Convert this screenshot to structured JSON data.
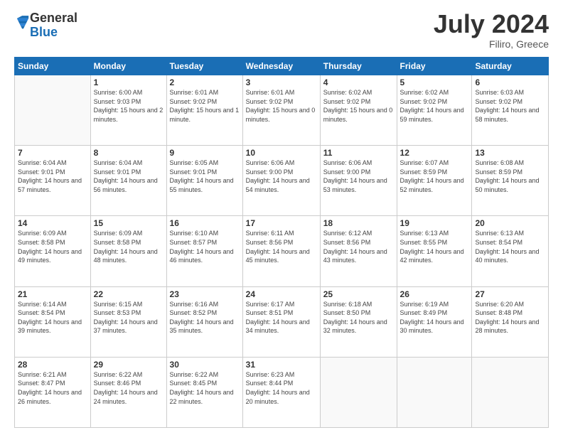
{
  "logo": {
    "general": "General",
    "blue": "Blue"
  },
  "title": {
    "month_year": "July 2024",
    "location": "Filiro, Greece"
  },
  "weekdays": [
    "Sunday",
    "Monday",
    "Tuesday",
    "Wednesday",
    "Thursday",
    "Friday",
    "Saturday"
  ],
  "weeks": [
    [
      {
        "day": "",
        "sunrise": "",
        "sunset": "",
        "daylight": ""
      },
      {
        "day": "1",
        "sunrise": "Sunrise: 6:00 AM",
        "sunset": "Sunset: 9:03 PM",
        "daylight": "Daylight: 15 hours and 2 minutes."
      },
      {
        "day": "2",
        "sunrise": "Sunrise: 6:01 AM",
        "sunset": "Sunset: 9:02 PM",
        "daylight": "Daylight: 15 hours and 1 minute."
      },
      {
        "day": "3",
        "sunrise": "Sunrise: 6:01 AM",
        "sunset": "Sunset: 9:02 PM",
        "daylight": "Daylight: 15 hours and 0 minutes."
      },
      {
        "day": "4",
        "sunrise": "Sunrise: 6:02 AM",
        "sunset": "Sunset: 9:02 PM",
        "daylight": "Daylight: 15 hours and 0 minutes."
      },
      {
        "day": "5",
        "sunrise": "Sunrise: 6:02 AM",
        "sunset": "Sunset: 9:02 PM",
        "daylight": "Daylight: 14 hours and 59 minutes."
      },
      {
        "day": "6",
        "sunrise": "Sunrise: 6:03 AM",
        "sunset": "Sunset: 9:02 PM",
        "daylight": "Daylight: 14 hours and 58 minutes."
      }
    ],
    [
      {
        "day": "7",
        "sunrise": "Sunrise: 6:04 AM",
        "sunset": "Sunset: 9:01 PM",
        "daylight": "Daylight: 14 hours and 57 minutes."
      },
      {
        "day": "8",
        "sunrise": "Sunrise: 6:04 AM",
        "sunset": "Sunset: 9:01 PM",
        "daylight": "Daylight: 14 hours and 56 minutes."
      },
      {
        "day": "9",
        "sunrise": "Sunrise: 6:05 AM",
        "sunset": "Sunset: 9:01 PM",
        "daylight": "Daylight: 14 hours and 55 minutes."
      },
      {
        "day": "10",
        "sunrise": "Sunrise: 6:06 AM",
        "sunset": "Sunset: 9:00 PM",
        "daylight": "Daylight: 14 hours and 54 minutes."
      },
      {
        "day": "11",
        "sunrise": "Sunrise: 6:06 AM",
        "sunset": "Sunset: 9:00 PM",
        "daylight": "Daylight: 14 hours and 53 minutes."
      },
      {
        "day": "12",
        "sunrise": "Sunrise: 6:07 AM",
        "sunset": "Sunset: 8:59 PM",
        "daylight": "Daylight: 14 hours and 52 minutes."
      },
      {
        "day": "13",
        "sunrise": "Sunrise: 6:08 AM",
        "sunset": "Sunset: 8:59 PM",
        "daylight": "Daylight: 14 hours and 50 minutes."
      }
    ],
    [
      {
        "day": "14",
        "sunrise": "Sunrise: 6:09 AM",
        "sunset": "Sunset: 8:58 PM",
        "daylight": "Daylight: 14 hours and 49 minutes."
      },
      {
        "day": "15",
        "sunrise": "Sunrise: 6:09 AM",
        "sunset": "Sunset: 8:58 PM",
        "daylight": "Daylight: 14 hours and 48 minutes."
      },
      {
        "day": "16",
        "sunrise": "Sunrise: 6:10 AM",
        "sunset": "Sunset: 8:57 PM",
        "daylight": "Daylight: 14 hours and 46 minutes."
      },
      {
        "day": "17",
        "sunrise": "Sunrise: 6:11 AM",
        "sunset": "Sunset: 8:56 PM",
        "daylight": "Daylight: 14 hours and 45 minutes."
      },
      {
        "day": "18",
        "sunrise": "Sunrise: 6:12 AM",
        "sunset": "Sunset: 8:56 PM",
        "daylight": "Daylight: 14 hours and 43 minutes."
      },
      {
        "day": "19",
        "sunrise": "Sunrise: 6:13 AM",
        "sunset": "Sunset: 8:55 PM",
        "daylight": "Daylight: 14 hours and 42 minutes."
      },
      {
        "day": "20",
        "sunrise": "Sunrise: 6:13 AM",
        "sunset": "Sunset: 8:54 PM",
        "daylight": "Daylight: 14 hours and 40 minutes."
      }
    ],
    [
      {
        "day": "21",
        "sunrise": "Sunrise: 6:14 AM",
        "sunset": "Sunset: 8:54 PM",
        "daylight": "Daylight: 14 hours and 39 minutes."
      },
      {
        "day": "22",
        "sunrise": "Sunrise: 6:15 AM",
        "sunset": "Sunset: 8:53 PM",
        "daylight": "Daylight: 14 hours and 37 minutes."
      },
      {
        "day": "23",
        "sunrise": "Sunrise: 6:16 AM",
        "sunset": "Sunset: 8:52 PM",
        "daylight": "Daylight: 14 hours and 35 minutes."
      },
      {
        "day": "24",
        "sunrise": "Sunrise: 6:17 AM",
        "sunset": "Sunset: 8:51 PM",
        "daylight": "Daylight: 14 hours and 34 minutes."
      },
      {
        "day": "25",
        "sunrise": "Sunrise: 6:18 AM",
        "sunset": "Sunset: 8:50 PM",
        "daylight": "Daylight: 14 hours and 32 minutes."
      },
      {
        "day": "26",
        "sunrise": "Sunrise: 6:19 AM",
        "sunset": "Sunset: 8:49 PM",
        "daylight": "Daylight: 14 hours and 30 minutes."
      },
      {
        "day": "27",
        "sunrise": "Sunrise: 6:20 AM",
        "sunset": "Sunset: 8:48 PM",
        "daylight": "Daylight: 14 hours and 28 minutes."
      }
    ],
    [
      {
        "day": "28",
        "sunrise": "Sunrise: 6:21 AM",
        "sunset": "Sunset: 8:47 PM",
        "daylight": "Daylight: 14 hours and 26 minutes."
      },
      {
        "day": "29",
        "sunrise": "Sunrise: 6:22 AM",
        "sunset": "Sunset: 8:46 PM",
        "daylight": "Daylight: 14 hours and 24 minutes."
      },
      {
        "day": "30",
        "sunrise": "Sunrise: 6:22 AM",
        "sunset": "Sunset: 8:45 PM",
        "daylight": "Daylight: 14 hours and 22 minutes."
      },
      {
        "day": "31",
        "sunrise": "Sunrise: 6:23 AM",
        "sunset": "Sunset: 8:44 PM",
        "daylight": "Daylight: 14 hours and 20 minutes."
      },
      {
        "day": "",
        "sunrise": "",
        "sunset": "",
        "daylight": ""
      },
      {
        "day": "",
        "sunrise": "",
        "sunset": "",
        "daylight": ""
      },
      {
        "day": "",
        "sunrise": "",
        "sunset": "",
        "daylight": ""
      }
    ]
  ]
}
